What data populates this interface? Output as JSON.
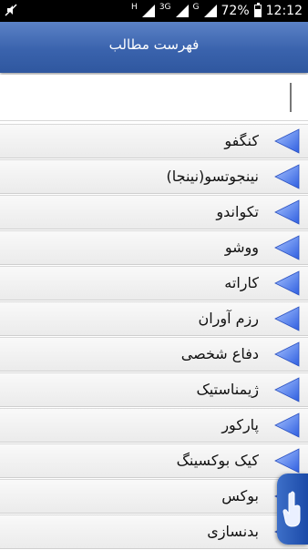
{
  "status_bar": {
    "network_top": "H",
    "network_mid": "3G",
    "network_g": "G",
    "battery": "72%",
    "time": "12:12"
  },
  "header": {
    "title": "فهرست مطالب"
  },
  "search": {
    "value": "",
    "placeholder": ""
  },
  "list": {
    "items": [
      {
        "label": "کنگفو"
      },
      {
        "label": "نینجوتسو(نینجا)"
      },
      {
        "label": "تکواندو"
      },
      {
        "label": "ووشو"
      },
      {
        "label": "کاراته"
      },
      {
        "label": "رزم آوران"
      },
      {
        "label": "دفاع شخصی"
      },
      {
        "label": "ژیمناستیک"
      },
      {
        "label": "پارکور"
      },
      {
        "label": "کیک بوکسینگ"
      },
      {
        "label": "بوکس"
      },
      {
        "label": "بدنسازی"
      }
    ]
  },
  "colors": {
    "header_top": "#5b82c6",
    "header_bottom": "#2f579f",
    "arrow": "#2f5fe0",
    "fab": "#1b4aa8"
  }
}
